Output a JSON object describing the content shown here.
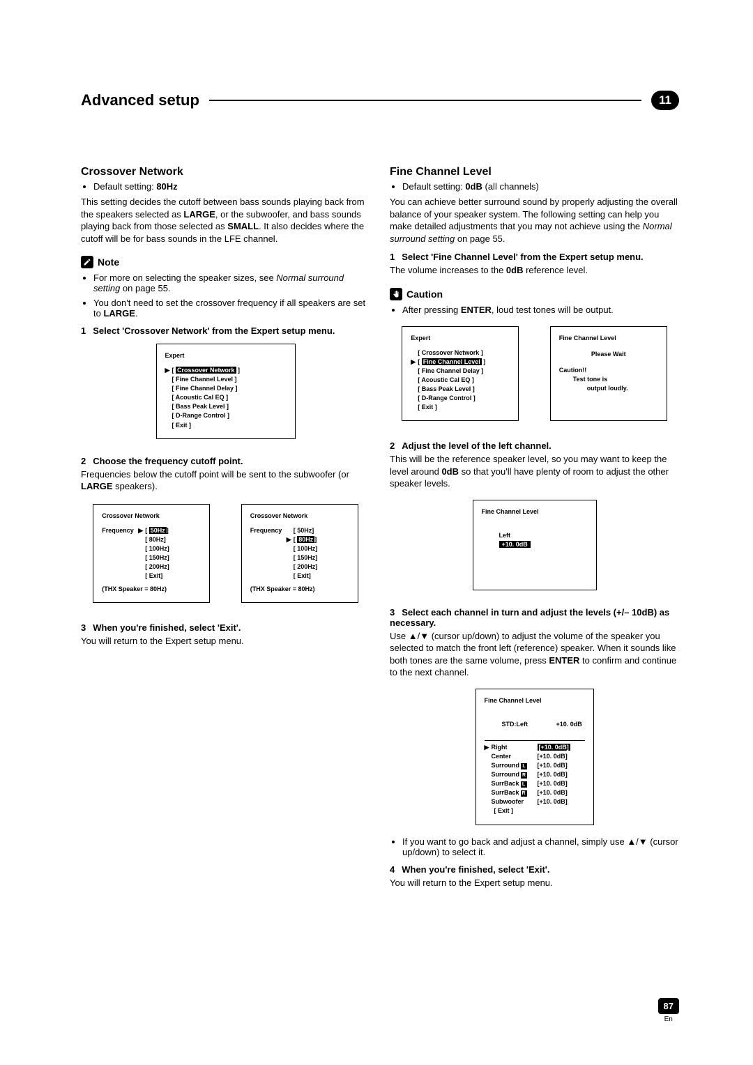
{
  "header": {
    "title": "Advanced setup",
    "chapter": "11"
  },
  "crossover": {
    "heading": "Crossover Network",
    "default_prefix": "Default setting: ",
    "default_value": "80Hz",
    "intro_a": "This setting decides the cutoff between bass sounds playing back from the speakers selected as ",
    "intro_b": ", or the subwoofer, and bass sounds playing back from those selected as ",
    "intro_c": ". It also decides where the cutoff will be for bass sounds in the LFE channel.",
    "large": "LARGE",
    "small": "SMALL",
    "note_label": "Note",
    "note1_a": "For more on selecting the speaker sizes, see ",
    "note1_b": "Normal surround setting",
    "note1_c": " on page 55.",
    "note2_a": "You don't need to set the crossover frequency if all speakers are set to ",
    "note2_b": "LARGE",
    "note2_c": ".",
    "step1": "Select 'Crossover Network' from the Expert setup menu.",
    "step2": "Choose the frequency cutoff point.",
    "step2_body_a": "Frequencies below the cutoff point will be sent to the subwoofer (or ",
    "step2_body_b": "LARGE",
    "step2_body_c": " speakers).",
    "step3": "When you're finished, select 'Exit'.",
    "step3_body": "You will return to the Expert setup menu."
  },
  "expert_menu": {
    "title": "Expert",
    "items": [
      "Crossover Network",
      "Fine Channel Level",
      "Fine Channel Delay",
      "Acoustic Cal EQ",
      "Bass Peak Level",
      "D-Range Control",
      "Exit"
    ],
    "selected_index": 0
  },
  "crossover_osd": {
    "title": "Crossover Network",
    "label": "Frequency",
    "options": [
      "50Hz",
      "80Hz",
      "100Hz",
      "150Hz",
      "200Hz",
      "Exit"
    ],
    "footer": "(THX Speaker = 80Hz)",
    "sel_a": 0,
    "sel_b": 1
  },
  "fcl": {
    "heading": "Fine Channel Level",
    "default_prefix": "Default setting: ",
    "default_value": "0dB",
    "default_suffix": " (all channels)",
    "intro_a": "You can achieve better surround sound by properly adjusting the overall balance of your speaker system. The following setting can help you make detailed adjustments that you may not achieve using the ",
    "intro_b": "Normal surround setting",
    "intro_c": " on page 55.",
    "step1": "Select 'Fine Channel Level' from the Expert setup menu.",
    "step1_body_a": "The volume increases to the ",
    "step1_body_b": "0dB",
    "step1_body_c": " reference level.",
    "caution_label": "Caution",
    "caution_body_a": "After pressing ",
    "caution_body_b": "ENTER",
    "caution_body_c": ", loud test tones will be output.",
    "step2": "Adjust the level of the left channel.",
    "step2_body_a": "This will be the reference speaker level, so you may want to keep the level around ",
    "step2_body_b": "0dB",
    "step2_body_c": " so that you'll have plenty of room to adjust the other speaker levels.",
    "step3_a": "Select each channel in turn and adjust the levels (",
    "step3_b": "+/– 10dB",
    "step3_c": ") as necessary.",
    "step3_body_a": "Use ",
    "step3_body_arrows": "▲/▼",
    "step3_body_b": " (cursor up/down) to adjust the volume of the speaker you selected to match the front left (reference) speaker. When it sounds like both tones are the same volume, press ",
    "step3_body_enter": "ENTER",
    "step3_body_c": " to confirm and continue to the next channel.",
    "tip_a": "If you want to go back and adjust a channel, simply use ",
    "tip_arrows": "▲/▼",
    "tip_b": " (cursor up/down) to select it.",
    "step4": "When you're finished, select 'Exit'.",
    "step4_body": "You will return to the Expert setup menu."
  },
  "expert_menu2": {
    "title": "Expert",
    "items": [
      "Crossover Network",
      "Fine Channel Level",
      "Fine Channel Delay",
      "Acoustic Cal EQ",
      "Bass Peak Level",
      "D-Range Control",
      "Exit"
    ],
    "selected_index": 1
  },
  "fcl_wait": {
    "title": "Fine  Channel  Level",
    "line1": "Please  Wait",
    "line2": "Caution!!",
    "line3": "Test  tone  is",
    "line4": "output  loudly."
  },
  "fcl_left": {
    "title": "Fine  Channel  Level",
    "label": "Left",
    "value": "+10. 0dB"
  },
  "fcl_list": {
    "title": "Fine  Channel  Level",
    "ref_label": "STD:Left",
    "ref_value": "+10. 0dB",
    "rows": [
      {
        "name": "Right",
        "lr": "",
        "val": "+10. 0dB",
        "sel": true
      },
      {
        "name": "Center",
        "lr": "",
        "val": "+10. 0dB"
      },
      {
        "name": "Surround",
        "lr": "L",
        "val": "+10. 0dB"
      },
      {
        "name": "Surround",
        "lr": "R",
        "val": "+10. 0dB"
      },
      {
        "name": "SurrBack",
        "lr": "L",
        "val": "+10. 0dB"
      },
      {
        "name": "SurrBack",
        "lr": "R",
        "val": "+10. 0dB"
      },
      {
        "name": "Subwoofer",
        "lr": "",
        "val": "+10. 0dB"
      }
    ],
    "exit": "[ Exit ]"
  },
  "footer": {
    "page": "87",
    "lang": "En"
  }
}
